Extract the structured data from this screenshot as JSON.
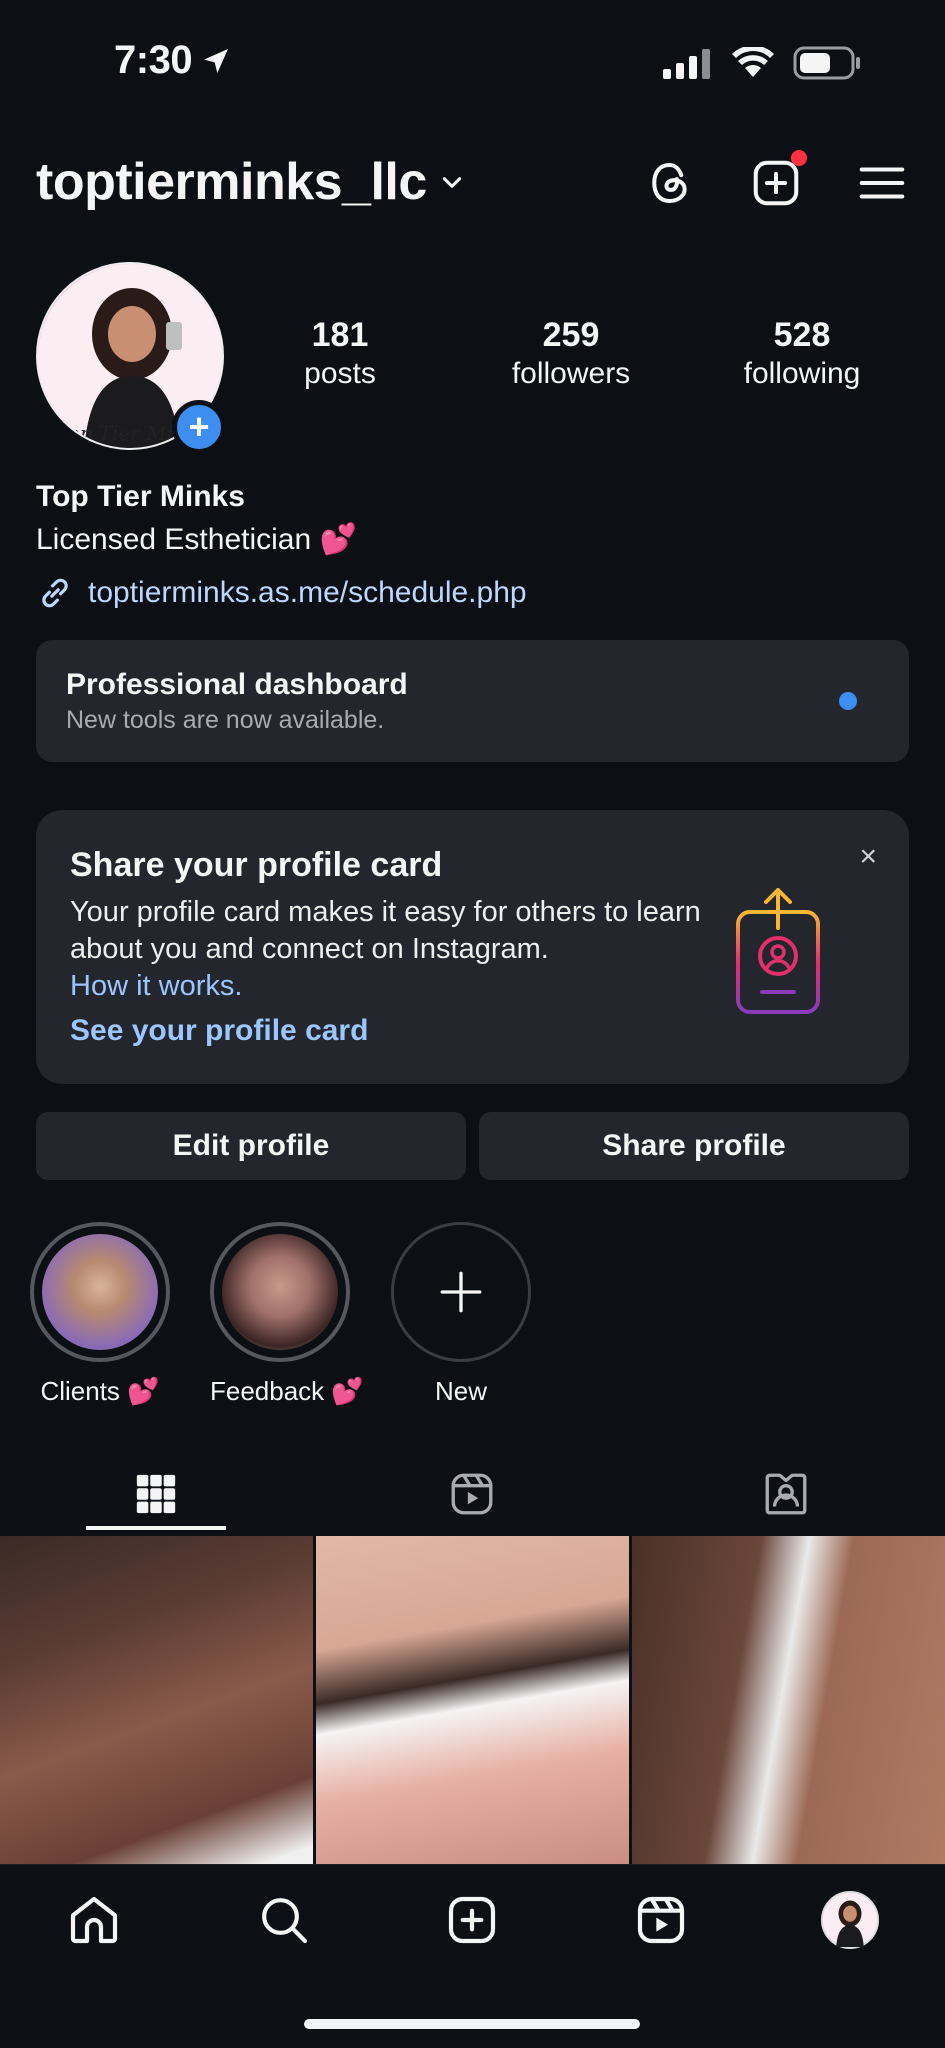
{
  "status_bar": {
    "time": "7:30"
  },
  "header": {
    "username": "toptierminks_llc"
  },
  "profile": {
    "stats": [
      {
        "num": "181",
        "label": "posts"
      },
      {
        "num": "259",
        "label": "followers"
      },
      {
        "num": "528",
        "label": "following"
      }
    ],
    "display_name": "Top Tier Minks",
    "bio": "Licensed Esthetician 💕",
    "link": "toptierminks.as.me/schedule.php"
  },
  "dashboard": {
    "title": "Professional dashboard",
    "subtitle": "New tools are now available."
  },
  "profile_card": {
    "title": "Share your profile card",
    "body": "Your profile card makes it easy for others to learn about you and connect on Instagram.",
    "how_link": "How it works.",
    "cta": "See your profile card",
    "close": "×"
  },
  "buttons": {
    "edit": "Edit profile",
    "share": "Share profile"
  },
  "highlights": [
    {
      "label": "Clients 💕"
    },
    {
      "label": "Feedback 💕"
    },
    {
      "label": "New"
    }
  ],
  "colors": {
    "background": "#0c0f14",
    "card": "#23262d",
    "link": "#9cc6ff",
    "accent": "#3d8ef0",
    "notification": "#ff3040"
  }
}
